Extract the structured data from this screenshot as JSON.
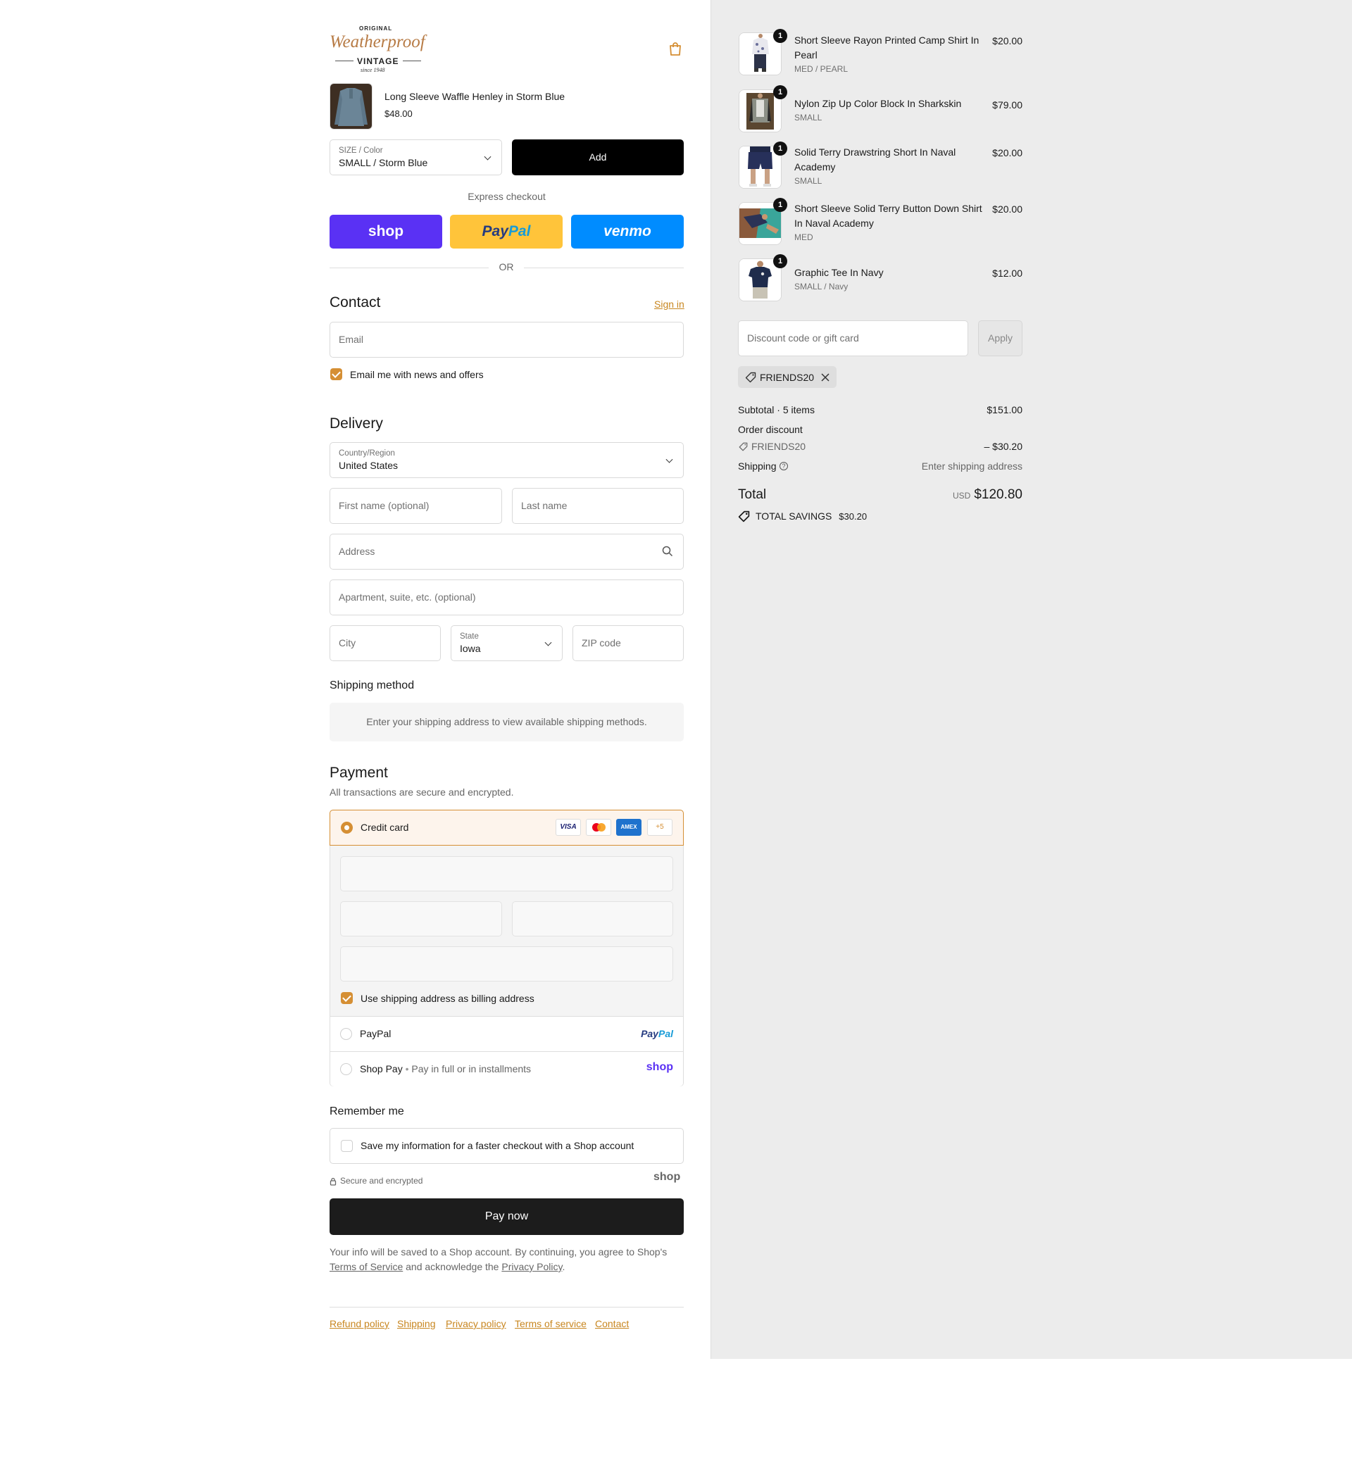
{
  "logo": {
    "top": "ORIGINAL",
    "script": "Weatherproof",
    "main": "VINTAGE",
    "since": "since 1948"
  },
  "upsell": {
    "name": "Long Sleeve Waffle Henley in Storm Blue",
    "price": "$48.00",
    "variant_label": "SIZE / Color",
    "variant_value": "SMALL / Storm Blue",
    "add_label": "Add"
  },
  "express": {
    "title": "Express checkout",
    "shop": "shop",
    "paypal_a": "Pay",
    "paypal_b": "Pal",
    "venmo": "venmo",
    "or": "OR"
  },
  "contact": {
    "title": "Contact",
    "signin": "Sign in",
    "email_placeholder": "Email",
    "news_label": "Email me with news and offers"
  },
  "delivery": {
    "title": "Delivery",
    "country_label": "Country/Region",
    "country_value": "United States",
    "first_placeholder": "First name (optional)",
    "last_placeholder": "Last name",
    "address_placeholder": "Address",
    "apt_placeholder": "Apartment, suite, etc. (optional)",
    "city_placeholder": "City",
    "state_label": "State",
    "state_value": "Iowa",
    "zip_placeholder": "ZIP code"
  },
  "shipping_method": {
    "title": "Shipping method",
    "message": "Enter your shipping address to view available shipping methods."
  },
  "payment": {
    "title": "Payment",
    "subtitle": "All transactions are secure and encrypted.",
    "credit_label": "Credit card",
    "card_brands": [
      "VISA",
      "MC",
      "AMEX"
    ],
    "more_cards": "+5",
    "billing_label": "Use shipping address as billing address",
    "paypal_label": "PayPal",
    "shoppay_label": "Shop Pay",
    "shoppay_desc": "Pay in full or in installments",
    "shop_logo": "shop"
  },
  "remember": {
    "title": "Remember me",
    "save_label": "Save my information for a faster checkout with a Shop account",
    "secure": "Secure and encrypted",
    "shop_logo": "shop"
  },
  "pay_now": "Pay now",
  "legal": {
    "text1": "Your info will be saved to a Shop account. By continuing, you agree to Shop's",
    "terms": "Terms of Service",
    "text2": "and acknowledge the",
    "privacy": "Privacy Policy",
    "end": "."
  },
  "footer": {
    "refund": "Refund policy",
    "shipping": "Shipping",
    "privacy": "Privacy policy",
    "terms": "Terms of service",
    "contact": "Contact"
  },
  "cart": {
    "items": [
      {
        "qty": "1",
        "name": "Short Sleeve Rayon Printed Camp Shirt In Pearl",
        "variant": "MED / PEARL",
        "price": "$20.00"
      },
      {
        "qty": "1",
        "name": "Nylon Zip Up Color Block In Sharkskin",
        "variant": "SMALL",
        "price": "$79.00"
      },
      {
        "qty": "1",
        "name": "Solid Terry Drawstring Short In Naval Academy",
        "variant": "SMALL",
        "price": "$20.00"
      },
      {
        "qty": "1",
        "name": "Short Sleeve Solid Terry Button Down Shirt In Naval Academy",
        "variant": "MED",
        "price": "$20.00"
      },
      {
        "qty": "1",
        "name": "Graphic Tee In Navy",
        "variant": "SMALL / Navy",
        "price": "$12.00"
      }
    ],
    "discount_placeholder": "Discount code or gift card",
    "apply_label": "Apply",
    "applied_code": "FRIENDS20"
  },
  "summary": {
    "subtotal_label": "Subtotal · 5 items",
    "subtotal_value": "$151.00",
    "discount_label": "Order discount",
    "discount_code": "FRIENDS20",
    "discount_value": "– $30.20",
    "shipping_label": "Shipping",
    "shipping_value": "Enter shipping address",
    "total_label": "Total",
    "currency": "USD",
    "total_value": "$120.80",
    "savings_label": "TOTAL SAVINGS",
    "savings_value": "$30.20"
  },
  "colors": {
    "accent": "#d58f34",
    "shop": "#5a31f4",
    "paypal_yellow": "#ffc43a",
    "venmo": "#008cff",
    "pay_button": "#1c1c1c"
  }
}
